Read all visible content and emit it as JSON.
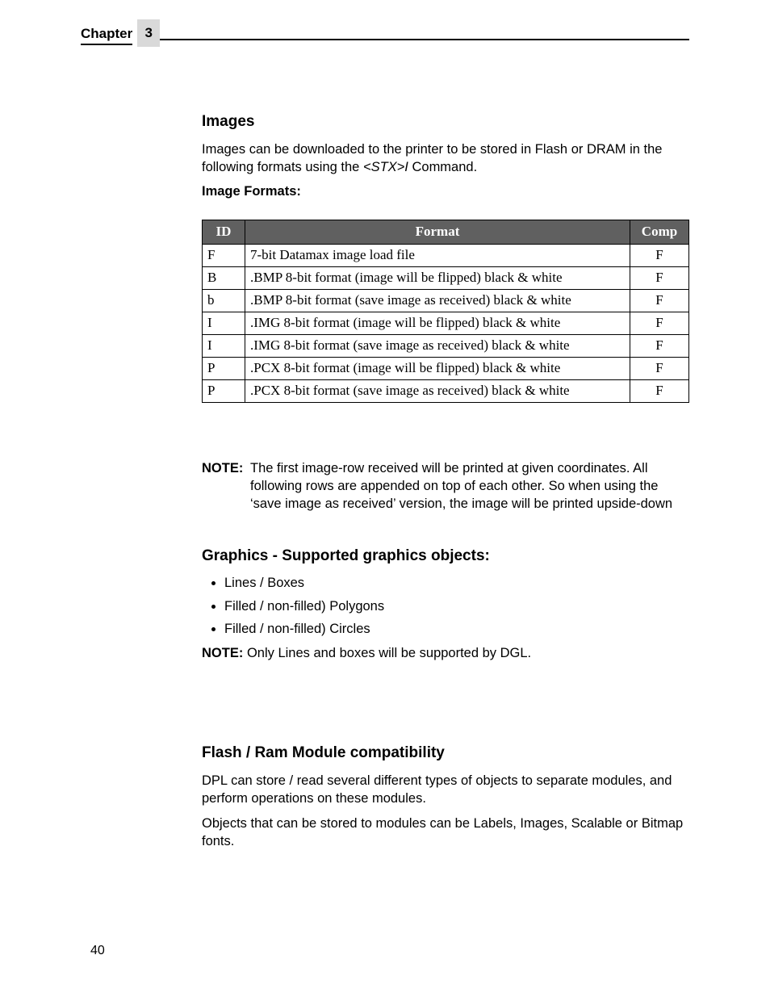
{
  "header": {
    "chapter_label": "Chapter",
    "chapter_number": "3"
  },
  "section_images": {
    "heading": "Images",
    "intro_a": "Images can be downloaded to the printer to be stored in Flash or DRAM in the following formats using the ",
    "intro_cmd": "<STX>I",
    "intro_b": " Command.",
    "formats_label": "Image Formats:"
  },
  "table": {
    "headers": {
      "id": "ID",
      "format": "Format",
      "comp": "Comp"
    },
    "rows": [
      {
        "id": "F",
        "format": "7-bit Datamax image load file",
        "comp": "F"
      },
      {
        "id": "B",
        "format": ".BMP 8-bit format (image will be flipped) black & white",
        "comp": "F"
      },
      {
        "id": "b",
        "format": ".BMP 8-bit format (save image as received) black & white",
        "comp": "F"
      },
      {
        "id": "I",
        "format": ".IMG 8-bit format (image will be flipped) black & white",
        "comp": "F"
      },
      {
        "id": "I",
        "format": ".IMG 8-bit format (save image as received) black & white",
        "comp": "F"
      },
      {
        "id": "P",
        "format": ".PCX 8-bit format (image will be flipped) black & white",
        "comp": "F"
      },
      {
        "id": "P",
        "format": ".PCX 8-bit format (save image as received) black & white",
        "comp": "F"
      }
    ]
  },
  "note1": {
    "label": "NOTE:",
    "text": "The first image-row received will be printed at given coordinates. All following rows are appended on top of each other. So when using the ‘save image as received’ version, the image will be printed upside-down"
  },
  "section_graphics": {
    "heading": "Graphics - Supported graphics objects:",
    "items": [
      "Lines / Boxes",
      "Filled / non-filled) Polygons",
      "Filled / non-filled) Circles"
    ],
    "note_label": "NOTE:",
    "note_text": "Only Lines and boxes will be supported by DGL."
  },
  "section_flash": {
    "heading": "Flash / Ram Module compatibility",
    "p1": "DPL can store / read several different types of objects to separate modules, and perform operations on these modules.",
    "p2": "Objects that can be stored to modules can be Labels, Images, Scalable or Bitmap fonts."
  },
  "page_number": "40"
}
